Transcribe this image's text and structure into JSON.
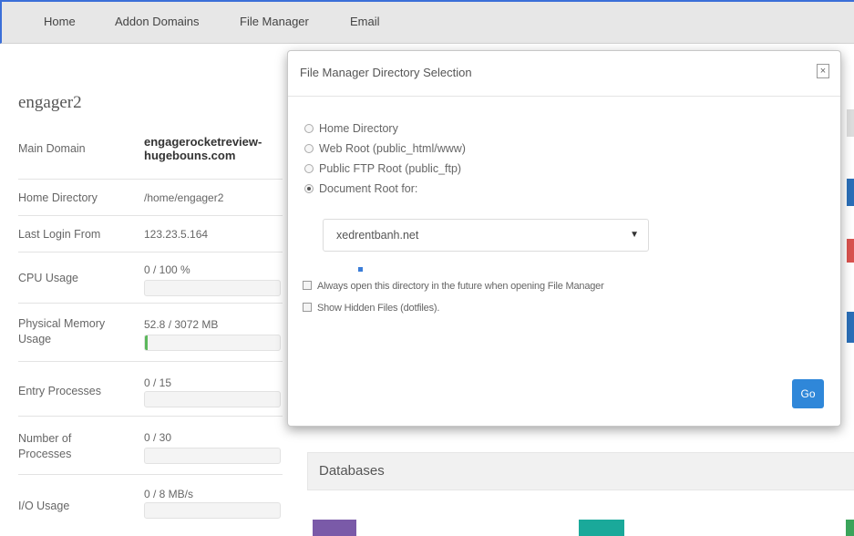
{
  "nav": {
    "items": [
      "Home",
      "Addon Domains",
      "File Manager",
      "Email"
    ]
  },
  "account": {
    "name": "engager2",
    "stats": [
      {
        "label": "Main Domain",
        "value": "engagerocketreview-hugebouns.com",
        "bold": true
      },
      {
        "label": "Home Directory",
        "value": "/home/engager2"
      },
      {
        "label": "Last Login From",
        "value": "123.23.5.164"
      },
      {
        "label": "CPU Usage",
        "value": "0 / 100 %",
        "progress": 0
      },
      {
        "label": "Physical Memory Usage",
        "value": "52.8 / 3072 MB",
        "progress": 0.017
      },
      {
        "label": "Entry Processes",
        "value": "0 / 15",
        "progress": 0
      },
      {
        "label": "Number of Processes",
        "value": "0 / 30",
        "progress": 0
      },
      {
        "label": "I/O Usage",
        "value": "0 / 8 MB/s",
        "progress": 0
      }
    ]
  },
  "databases": {
    "title": "Databases"
  },
  "modal": {
    "title": "File Manager  Directory Selection",
    "close_label": "×",
    "radios": [
      {
        "label": "Home Directory",
        "checked": false
      },
      {
        "label": "Web Root (public_html/www)",
        "checked": false
      },
      {
        "label": "Public FTP Root (public_ftp)",
        "checked": false
      },
      {
        "label": "Document Root for:",
        "checked": true
      }
    ],
    "domain_select": "xedrentbanh.net",
    "checkboxes": [
      {
        "label": "Always open this directory in the future when opening File Manager",
        "checked": false
      },
      {
        "label": "Show Hidden Files (dotfiles).",
        "checked": false
      }
    ],
    "go_label": "Go"
  },
  "colors": {
    "accent": "#2f87d9",
    "progress": "#5cb85c",
    "topbar": "#e7e7e7"
  }
}
